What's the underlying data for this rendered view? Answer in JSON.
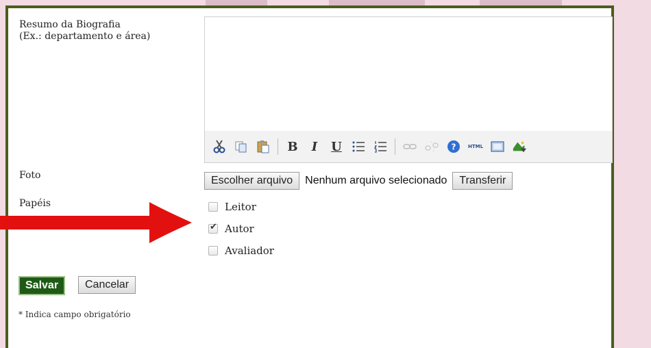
{
  "form": {
    "bio_label_line1": "Resumo da Biografia",
    "bio_label_line2": "(Ex.: departamento e área)",
    "photo_label": "Foto",
    "roles_label": "Papéis",
    "file_choose_label": "Escolher arquivo",
    "file_status": "Nenhum arquivo selecionado",
    "upload_label": "Transferir",
    "roles": [
      {
        "label": "Leitor",
        "checked": false
      },
      {
        "label": "Autor",
        "checked": true
      },
      {
        "label": "Avaliador",
        "checked": false
      }
    ],
    "save_label": "Salvar",
    "cancel_label": "Cancelar",
    "required_note": "* Indica campo obrigatório"
  },
  "toolbar": {
    "icons": [
      "cut-icon",
      "copy-icon",
      "paste-icon",
      "bold-icon",
      "italic-icon",
      "underline-icon",
      "bullet-list-icon",
      "numbered-list-icon",
      "link-icon",
      "unlink-icon",
      "help-icon",
      "html-icon",
      "fullscreen-icon",
      "image-icon"
    ],
    "bold_glyph": "B",
    "italic_glyph": "I",
    "underline_glyph": "U",
    "html_glyph": "HTML"
  },
  "colors": {
    "panel_border": "#4a5e1c",
    "save_bg": "#1e5a16",
    "arrow": "#e31010"
  }
}
